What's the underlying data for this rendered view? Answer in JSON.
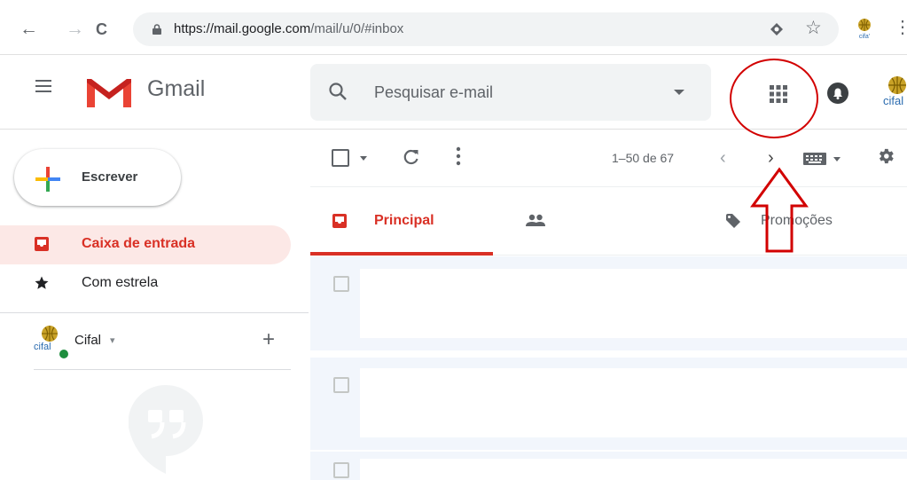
{
  "browser": {
    "back_label": "←",
    "forward_label": "→",
    "reload_label": "C",
    "url_host": "https://mail.google.com",
    "url_path": "/mail/u/0/#inbox",
    "menu_label": "⋮",
    "star_label": "☆"
  },
  "header": {
    "app_name": "Gmail",
    "search_placeholder": "Pesquisar e-mail",
    "profile_logo_text": "cifal"
  },
  "sidebar": {
    "compose_label": "Escrever",
    "items": [
      {
        "label": "Caixa de entrada",
        "icon": "inbox-icon",
        "active": true
      },
      {
        "label": "Com estrela",
        "icon": "star-icon",
        "active": false
      }
    ],
    "hangouts": {
      "user_name": "Cifal",
      "caret": "▾",
      "add_label": "+",
      "avatar_logo_text": "cifal"
    }
  },
  "toolbar": {
    "more_label": "⋮",
    "pagination": "1–50 de 67",
    "prev_label": "‹",
    "next_label": "›"
  },
  "tabs": [
    {
      "label": "Principal",
      "icon": "inbox-tab-icon",
      "active": true
    },
    {
      "label": "",
      "icon": "social-people-icon",
      "active": false
    },
    {
      "label": "Promoções",
      "icon": "promotions-tag-icon",
      "active": false
    }
  ],
  "colors": {
    "accent_red": "#d93025",
    "annotation_red": "#d20000",
    "inbox_active_bg": "#fce8e6",
    "online_green": "#1e8e3e"
  }
}
